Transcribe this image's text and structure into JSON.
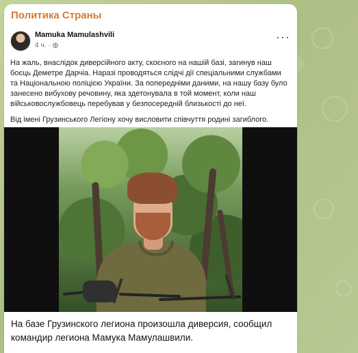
{
  "channel": {
    "name": "Политика Страны"
  },
  "post": {
    "author": "Mamuka Mamulashvili",
    "time": "4 ч.",
    "more_icon": "more-horizontal-icon",
    "privacy_icon": "globe-icon",
    "paragraphs": [
      "На жаль, внаслідок диверсійного акту, скоєного на нашій базі, загинув наш боєць Деметре Дарчіа. Наразі проводяться слідчі дії спеціальними службами та Національною поліцією України. За попередніми даними, на нашу базу було занесено вибухову речовину, яка здетонувала в той момент, коли наш військовослужбовець перебував у безпосередній близькості до неї.",
      "Від імені Грузинського Легіону хочу висловити співчуття родині загиблого."
    ]
  },
  "message": {
    "caption": "На базе Грузинского легиона произошла диверсия, сообщил командир легиона Мамука Мамулашвили."
  }
}
